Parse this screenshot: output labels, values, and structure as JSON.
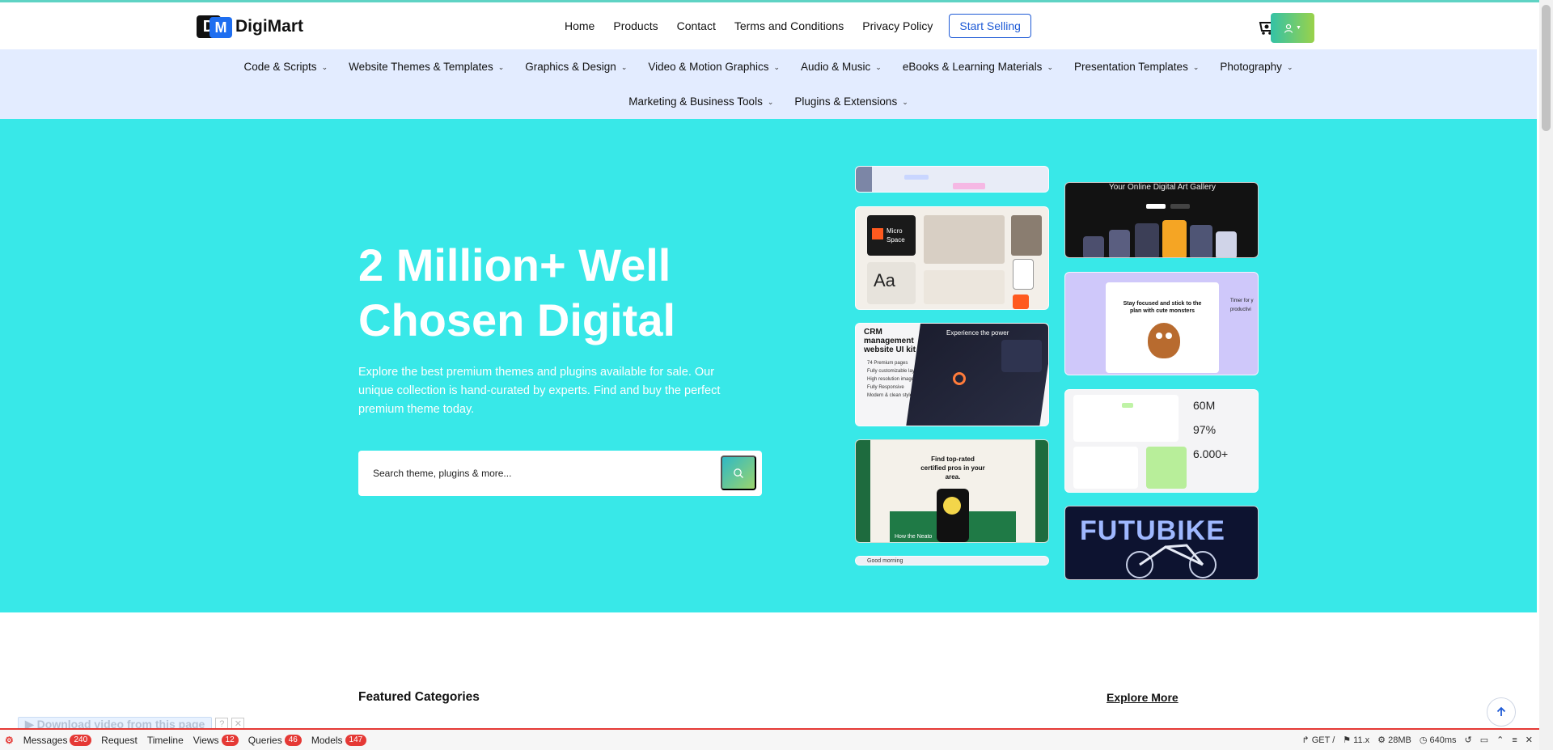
{
  "brand": {
    "logo_letters_1": "D",
    "logo_letters_2": "M",
    "name": "DigiMart"
  },
  "nav": {
    "links": [
      "Home",
      "Products",
      "Contact",
      "Terms and Conditions",
      "Privacy Policy"
    ],
    "cta": "Start Selling",
    "cart_count": "0"
  },
  "categories": {
    "row1": [
      "Code & Scripts",
      "Website Themes & Templates",
      "Graphics & Design",
      "Video & Motion Graphics",
      "Audio & Music",
      "eBooks & Learning Materials",
      "Presentation Templates",
      "Photography"
    ],
    "row2": [
      "Marketing & Business Tools",
      "Plugins & Extensions"
    ]
  },
  "hero": {
    "title_line1": "2 Million+ Well",
    "title_line2": "Chosen Digital",
    "description": "Explore the best premium themes and plugins available for sale. Our unique collection is hand-curated by experts. Find and buy the perfect premium theme today.",
    "search_placeholder": "Search theme, plugins & more...",
    "background": "#38e8e8"
  },
  "thumbnails": {
    "micro_space": "Micro Space",
    "crm": "CRM management website UI kit",
    "crm_list": [
      "74 Premium pages",
      "Fully customizable layers",
      "High resolution images",
      "Fully Responsive",
      "Modern & clean style"
    ],
    "crm_power": "Experience the power",
    "certified": "Find top-rated certified pros in your area.",
    "how": "How the Neato",
    "art_gallery": "Your Online Digital Art Gallery",
    "monsters": "Stay focused and stick to the plan with cute monsters",
    "timer": "Timer for y productivi",
    "stat1": "60M",
    "stat2": "97%",
    "stat3": "6.000+",
    "futubike": "FUTUBIKE",
    "good_morning": "Good morning"
  },
  "featured": {
    "title": "Featured Categories",
    "explore": "Explore More"
  },
  "download_bar": {
    "label": "Download video from this page"
  },
  "debugbar": {
    "items": [
      {
        "label": "Messages",
        "count": "240"
      },
      {
        "label": "Request",
        "count": ""
      },
      {
        "label": "Timeline",
        "count": ""
      },
      {
        "label": "Views",
        "count": "12"
      },
      {
        "label": "Queries",
        "count": "46"
      },
      {
        "label": "Models",
        "count": "147"
      }
    ],
    "method": "GET /",
    "php": "11.x",
    "memory": "28MB",
    "time": "640ms"
  }
}
